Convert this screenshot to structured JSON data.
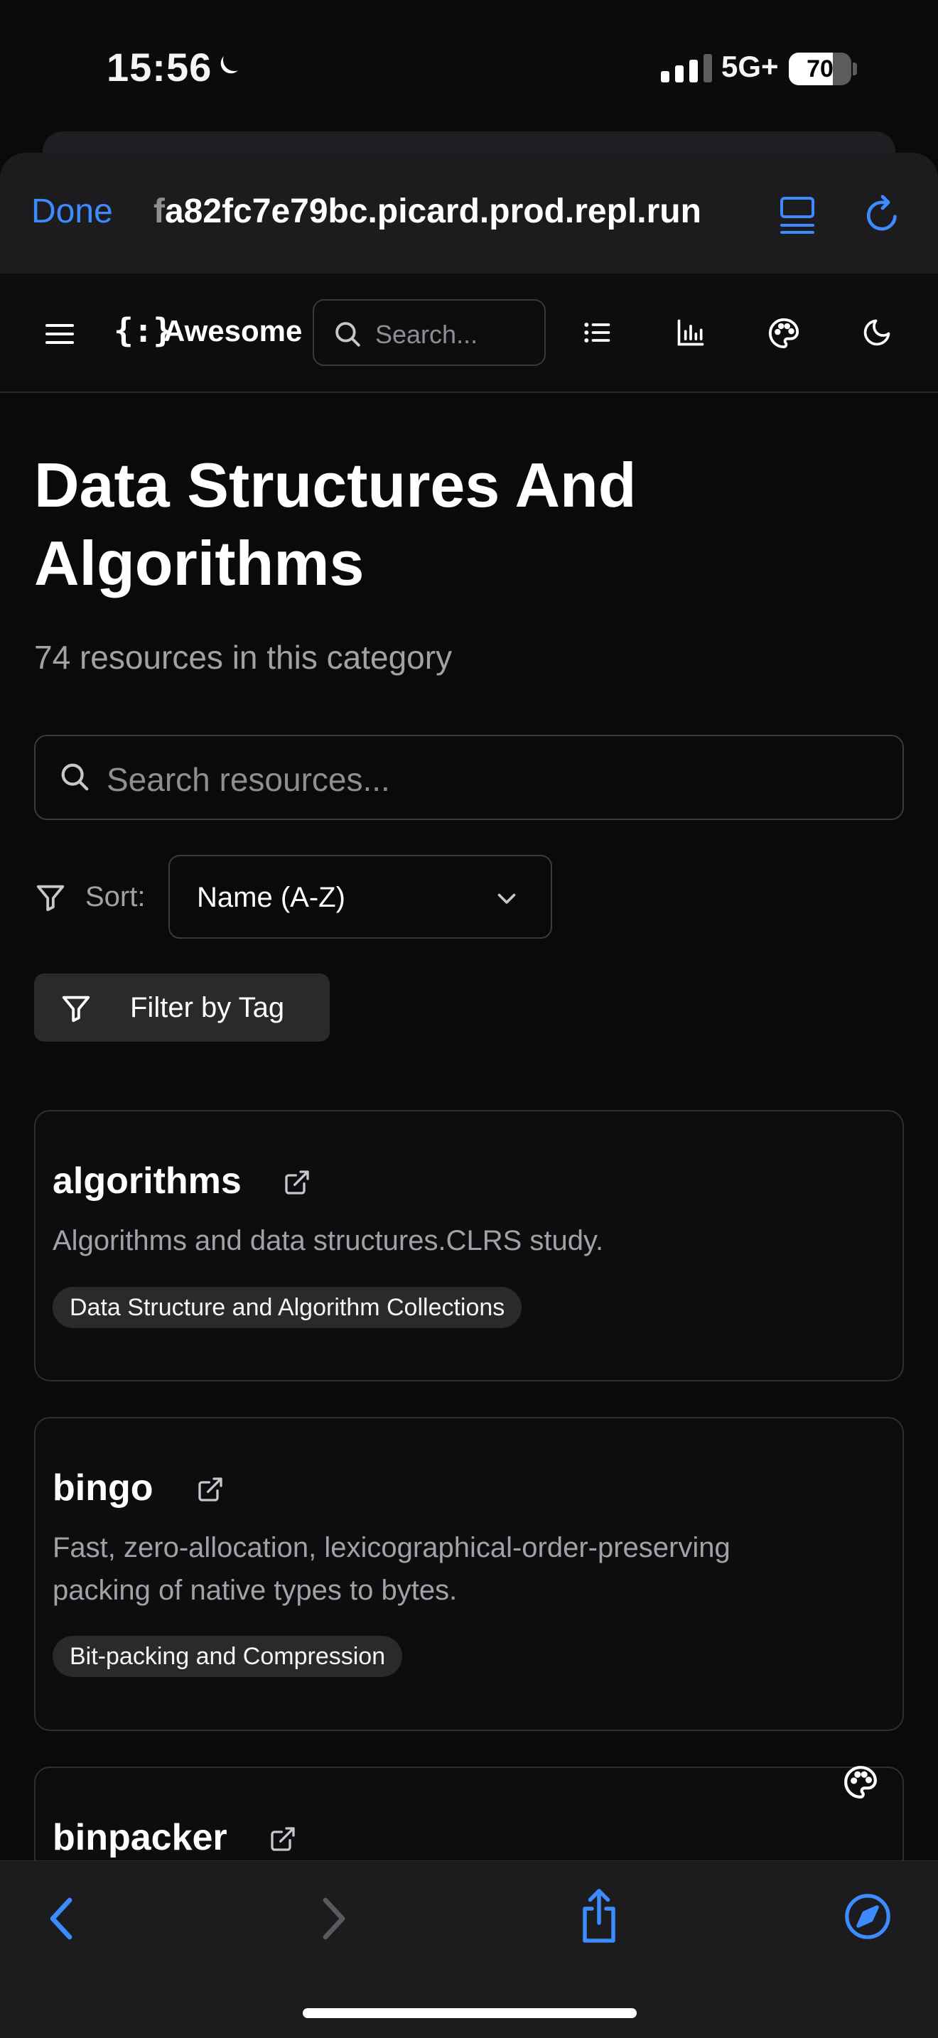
{
  "status_bar": {
    "time": "15:56",
    "network": "5G+",
    "battery": "70",
    "battery_level_pct": 70
  },
  "browser": {
    "done_label": "Done",
    "url_dim_prefix": "f",
    "url_rest": "a82fc7e79bc.picard.prod.repl.run"
  },
  "header": {
    "brand_icon_glyph": "{:}",
    "brand_name": "Awesome",
    "search_placeholder": "Search..."
  },
  "main": {
    "title": "Data Structures And Algorithms",
    "subtitle": "74 resources in this category",
    "search_placeholder": "Search resources...",
    "sort_label": "Sort:",
    "sort_value": "Name (A-Z)",
    "filter_label": "Filter by Tag"
  },
  "resources": [
    {
      "name": "algorithms",
      "description": "Algorithms and data structures.CLRS study.",
      "tag": "Data Structure and Algorithm Collections"
    },
    {
      "name": "bingo",
      "description": "Fast, zero-allocation, lexicographical-order-preserving packing of native types to bytes.",
      "tag": "Bit-packing and Compression"
    },
    {
      "name": "binpacker",
      "description": "",
      "tag": ""
    }
  ],
  "colors": {
    "accent": "#3d8bfd",
    "background": "#0a0a0b",
    "card_border": "#2f2f33",
    "muted_text": "#a1a1a6"
  },
  "icons": {
    "header": [
      "menu-icon",
      "list-icon",
      "chart-icon",
      "palette-icon",
      "moon-icon"
    ],
    "toolbar": [
      "back-icon",
      "forward-icon",
      "share-icon",
      "compass-icon"
    ]
  }
}
